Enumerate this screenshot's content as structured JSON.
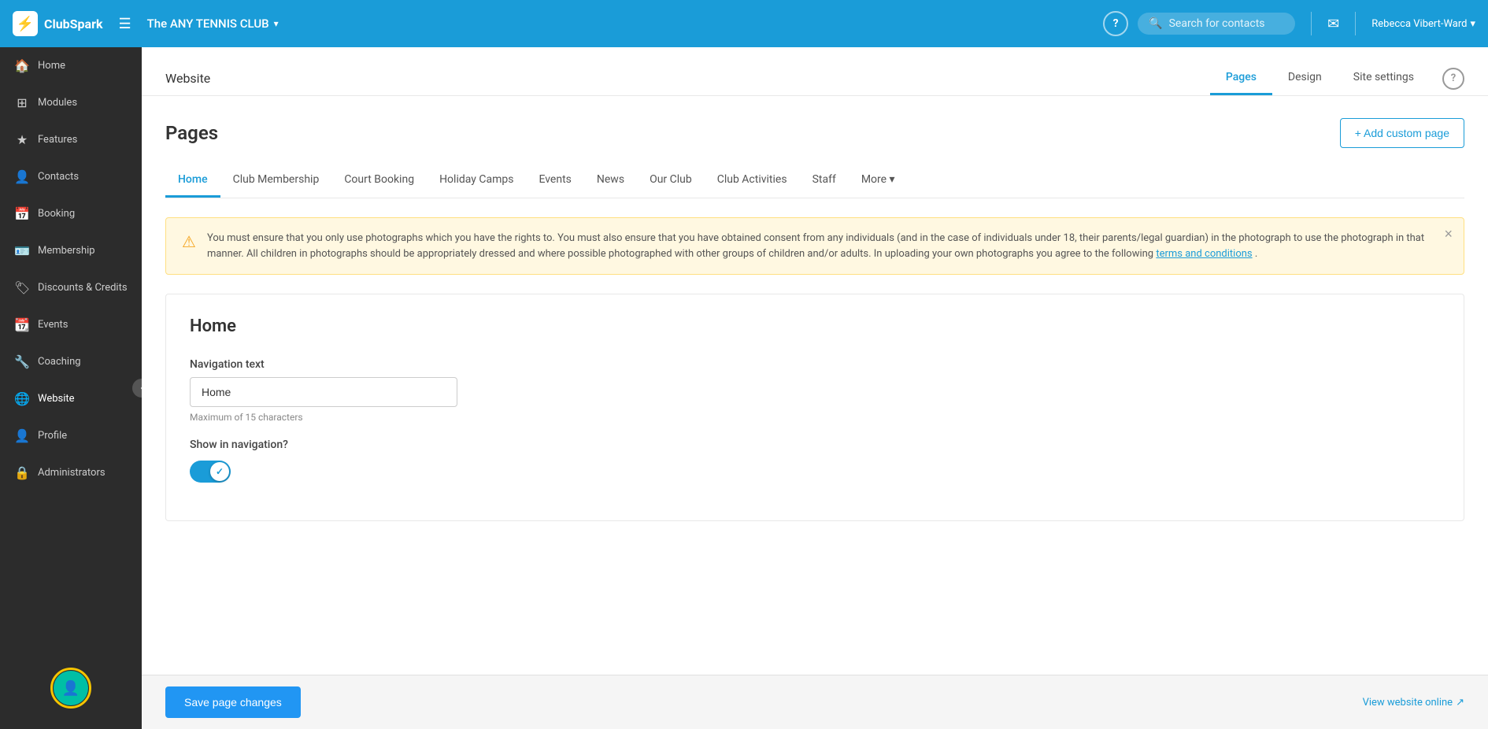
{
  "topnav": {
    "logo_text": "ClubSpark",
    "club_name": "The ANY TENNIS CLUB",
    "search_placeholder": "Search for contacts",
    "help_label": "?",
    "user_name": "Rebecca Vibert-Ward"
  },
  "sidebar": {
    "items": [
      {
        "id": "home",
        "label": "Home",
        "icon": "🏠"
      },
      {
        "id": "modules",
        "label": "Modules",
        "icon": "⊞"
      },
      {
        "id": "features",
        "label": "Features",
        "icon": "★"
      },
      {
        "id": "contacts",
        "label": "Contacts",
        "icon": "👤"
      },
      {
        "id": "booking",
        "label": "Booking",
        "icon": "📅"
      },
      {
        "id": "membership",
        "label": "Membership",
        "icon": "🪪"
      },
      {
        "id": "discounts-credits",
        "label": "Discounts & Credits",
        "icon": "🏷"
      },
      {
        "id": "events",
        "label": "Events",
        "icon": "📆"
      },
      {
        "id": "coaching",
        "label": "Coaching",
        "icon": "🔧"
      },
      {
        "id": "website",
        "label": "Website",
        "icon": "🌐",
        "active": true
      },
      {
        "id": "profile",
        "label": "Profile",
        "icon": "👤"
      },
      {
        "id": "administrators",
        "label": "Administrators",
        "icon": "🔒"
      }
    ]
  },
  "website_header": {
    "title": "Website",
    "tabs": [
      {
        "id": "pages",
        "label": "Pages",
        "active": true
      },
      {
        "id": "design",
        "label": "Design",
        "active": false
      },
      {
        "id": "site-settings",
        "label": "Site settings",
        "active": false
      }
    ]
  },
  "pages": {
    "title": "Pages",
    "add_custom_label": "+ Add custom page",
    "tabs": [
      {
        "id": "home",
        "label": "Home",
        "active": true
      },
      {
        "id": "club-membership",
        "label": "Club Membership",
        "active": false
      },
      {
        "id": "court-booking",
        "label": "Court Booking",
        "active": false
      },
      {
        "id": "holiday-camps",
        "label": "Holiday Camps",
        "active": false
      },
      {
        "id": "events",
        "label": "Events",
        "active": false
      },
      {
        "id": "news",
        "label": "News",
        "active": false
      },
      {
        "id": "our-club",
        "label": "Our Club",
        "active": false
      },
      {
        "id": "club-activities",
        "label": "Club Activities",
        "active": false
      },
      {
        "id": "staff",
        "label": "Staff",
        "active": false
      },
      {
        "id": "more",
        "label": "More ▾",
        "active": false
      }
    ],
    "alert": {
      "text": "You must ensure that you only use photographs which you have the rights to. You must also ensure that you have obtained consent from any individuals (and in the case of individuals under 18, their parents/legal guardian) in the photograph to use the photograph in that manner. All children in photographs should be appropriately dressed and where possible photographed with other groups of children and/or adults. In uploading your own photographs you agree to the following ",
      "link_text": "terms and conditions",
      "text_end": "."
    },
    "home_section": {
      "title": "Home",
      "nav_text_label": "Navigation text",
      "nav_text_value": "Home",
      "nav_text_hint": "Maximum of 15 characters",
      "show_nav_label": "Show in navigation?"
    },
    "save_button": "Save page changes",
    "view_website": "View website online"
  }
}
